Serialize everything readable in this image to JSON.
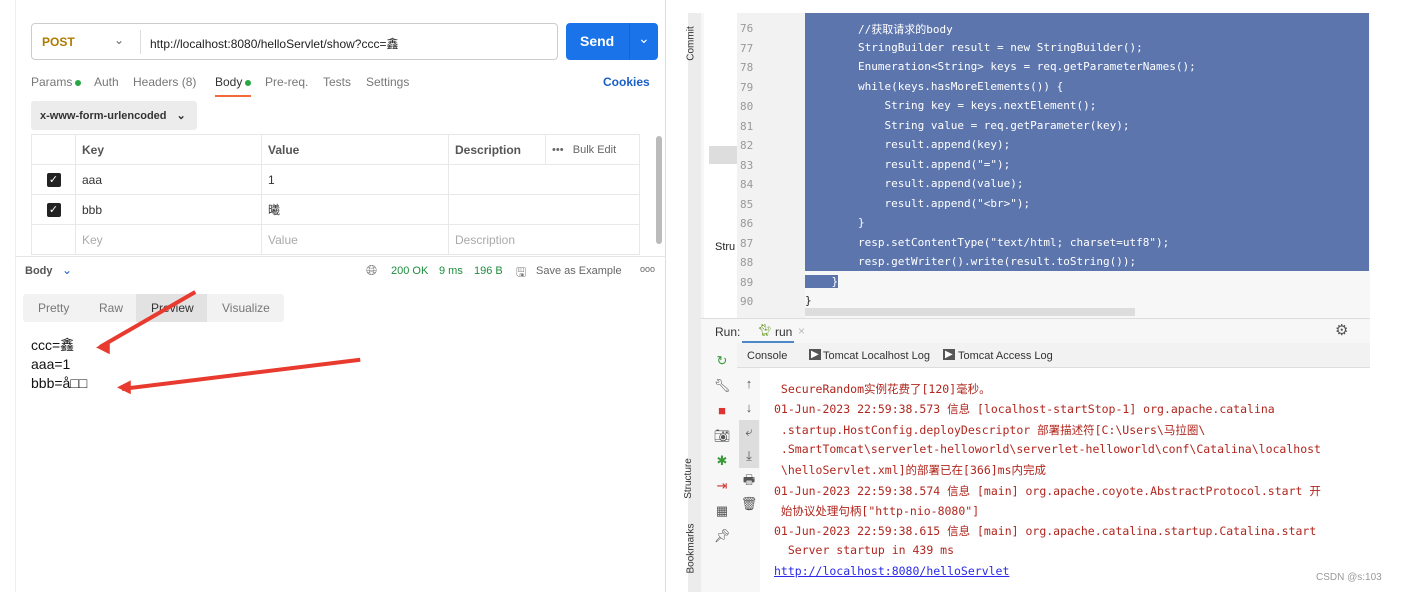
{
  "postman": {
    "method": "POST",
    "url": "http://localhost:8080/helloServlet/show?ccc=鑫",
    "send": "Send",
    "tabs": [
      "Params",
      "Auth",
      "Headers (8)",
      "Body",
      "Pre-req.",
      "Tests",
      "Settings"
    ],
    "cookies": "Cookies",
    "body_type": "x-www-form-urlencoded",
    "table": {
      "headers": [
        "Key",
        "Value",
        "Description"
      ],
      "bulk_edit": "Bulk Edit",
      "rows": [
        {
          "key": "aaa",
          "value": "1",
          "checked": true
        },
        {
          "key": "bbb",
          "value": "曦",
          "checked": true
        }
      ],
      "placeholders": [
        "Key",
        "Value",
        "Description"
      ]
    },
    "response": {
      "label": "Body",
      "status": "200 OK",
      "time": "9 ms",
      "size": "196 B",
      "save": "Save as Example",
      "tabs": [
        "Pretty",
        "Raw",
        "Preview",
        "Visualize"
      ],
      "active_tab": "Preview",
      "preview": [
        "ccc=鑫",
        "aaa=1",
        "bbb=å□□"
      ]
    }
  },
  "ide": {
    "side_labels": {
      "commit": "Commit",
      "structure": "Structure",
      "bookmarks": "Bookmarks",
      "stru": "Stru"
    },
    "line_numbers": [
      "76",
      "77",
      "78",
      "79",
      "80",
      "81",
      "82",
      "83",
      "84",
      "85",
      "86",
      "87",
      "88",
      "89",
      "90"
    ],
    "code": [
      "        //获取请求的body",
      "        StringBuilder result = new StringBuilder();",
      "        Enumeration<String> keys = req.getParameterNames();",
      "        while(keys.hasMoreElements()) {",
      "            String key = keys.nextElement();",
      "            String value = req.getParameter(key);",
      "            result.append(key);",
      "            result.append(\"=\");",
      "            result.append(value);",
      "            result.append(\"<br>\");",
      "        }",
      "        resp.setContentType(\"text/html; charset=utf8\");",
      "        resp.getWriter().write(result.toString());",
      "    }",
      "}"
    ],
    "run_label": "Run:",
    "run_tab": "run",
    "console_tabs": [
      "Console",
      "Tomcat Localhost Log",
      "Tomcat Access Log"
    ],
    "log": [
      " SecureRandom实例花费了[120]毫秒。",
      "01-Jun-2023 22:59:38.573 信息 [localhost-startStop-1] org.apache.catalina",
      " .startup.HostConfig.deployDescriptor 部署描述符[C:\\Users\\马拉圈\\",
      " .SmartTomcat\\serverlet-helloworld\\serverlet-helloworld\\conf\\Catalina\\localhost",
      " \\helloServlet.xml]的部署已在[366]ms内完成",
      "01-Jun-2023 22:59:38.574 信息 [main] org.apache.coyote.AbstractProtocol.start 开",
      " 始协议处理句柄[\"http-nio-8080\"]",
      "01-Jun-2023 22:59:38.615 信息 [main] org.apache.catalina.startup.Catalina.start",
      "  Server startup in 439 ms"
    ],
    "link": "http://localhost:8080/helloServlet"
  },
  "watermark": "CSDN @s:103"
}
